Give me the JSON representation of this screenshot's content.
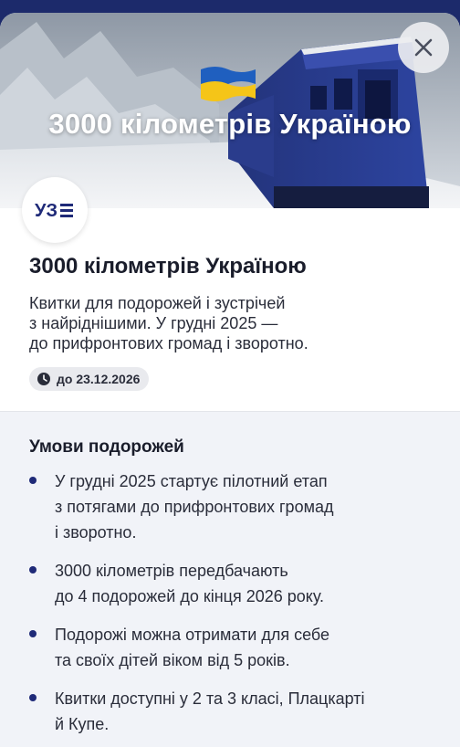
{
  "hero": {
    "title": "3000 кілометрів Україною",
    "flag_colors": {
      "top": "#1f5fbf",
      "bottom": "#f5c518"
    }
  },
  "close_icon": "close-icon",
  "logo": {
    "text": "УЗ",
    "color": "#1f2a78"
  },
  "offer": {
    "title": "3000 кілометрів Україною",
    "description_lines": [
      "Квитки для подорожей і зустрічей",
      "з найріднішими. У грудні 2025 —",
      "до прифронтових громад і зворотно."
    ],
    "valid_until": "до 23.12.2026",
    "valid_icon": "clock-icon"
  },
  "conditions": {
    "title": "Умови подорожей",
    "items": [
      [
        "У грудні 2025 стартує пілотний етап",
        "з потягами до прифронтових громад",
        "і зворотно."
      ],
      [
        "3000 кілометрів передбачають",
        "до 4 подорожей до кінця 2026 року."
      ],
      [
        "Подорожі можна отримати для себе",
        "та своїх дітей віком від 5 років."
      ],
      [
        "Квитки доступні у 2 та 3 класі, Плацкарті",
        "й Купе."
      ]
    ]
  },
  "colors": {
    "accent": "#1f2a78",
    "section_bg": "#f1f3f8",
    "header_bg": "#1c2a6b"
  }
}
